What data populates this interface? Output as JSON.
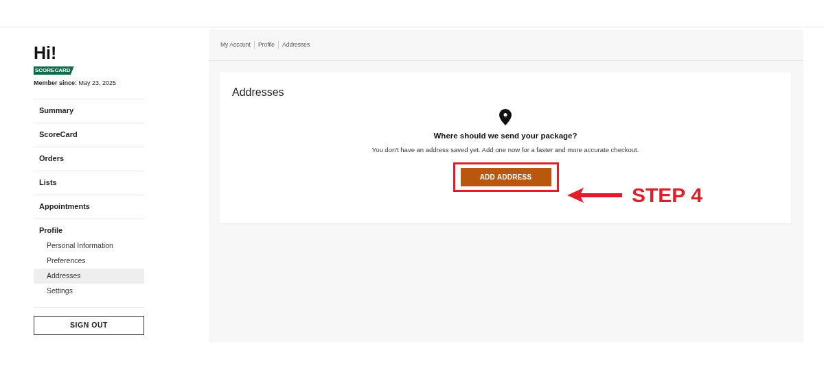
{
  "sidebar": {
    "greeting": "Hi!",
    "badge": "SCORECARD",
    "member_since": "**Member since:** May 23, 2025",
    "items": [
      {
        "label": "Summary",
        "selected": false
      },
      {
        "label": "ScoreCard",
        "selected": false
      },
      {
        "label": "Orders",
        "selected": false
      },
      {
        "label": "Lists",
        "selected": false
      },
      {
        "label": "Appointments",
        "selected": false
      },
      {
        "label": "Profile",
        "selected": false,
        "children": [
          {
            "label": "Personal Information",
            "selected": false
          },
          {
            "label": "Preferences",
            "selected": false
          },
          {
            "label": "Addresses",
            "selected": true
          },
          {
            "label": "Settings",
            "selected": false
          }
        ]
      }
    ],
    "sign_out": "SIGN OUT"
  },
  "breadcrumbs": [
    "My Account",
    "Profile",
    "Addresses"
  ],
  "card": {
    "title": "Addresses",
    "heading": "Where should we send your package?",
    "message": "You don't have an address saved yet. Add one now for a faster and more accurate checkout.",
    "button": "ADD ADDRESS"
  },
  "annotation": {
    "label": "STEP 4"
  }
}
